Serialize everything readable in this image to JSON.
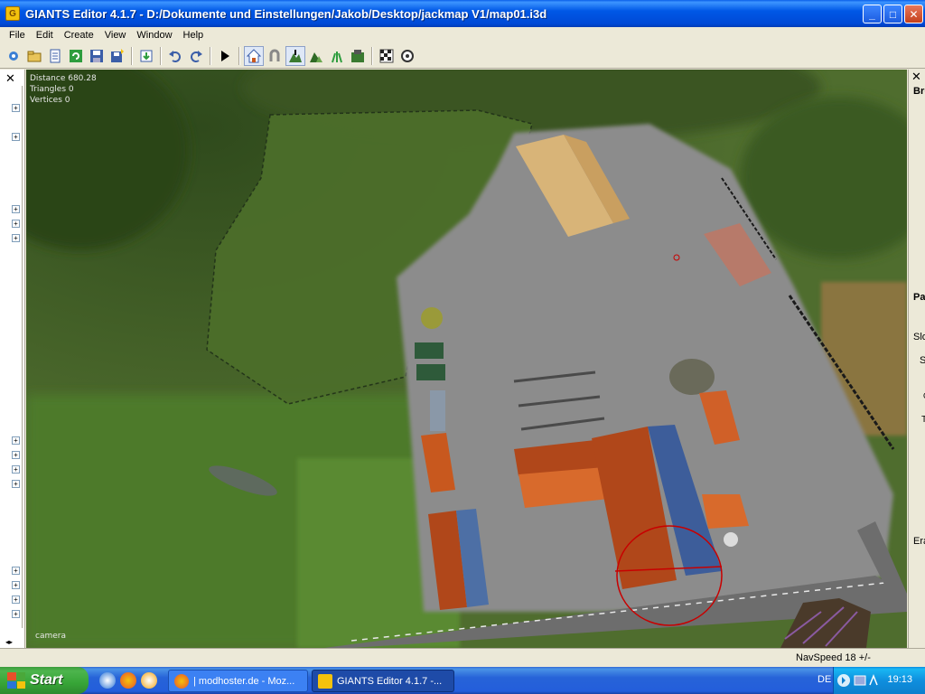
{
  "window": {
    "title": "GIANTS Editor 4.1.7 - D:/Dokumente und Einstellungen/Jakob/Desktop/jackmap V1/map01.i3d",
    "app_icon": "giants-logo-icon",
    "minimize": "_",
    "maximize": "□",
    "close": "✕"
  },
  "menu": {
    "items": [
      {
        "label": "File"
      },
      {
        "label": "Edit"
      },
      {
        "label": "Create"
      },
      {
        "label": "View"
      },
      {
        "label": "Window"
      },
      {
        "label": "Help"
      }
    ]
  },
  "toolbar": {
    "buttons": [
      "new-scene-icon",
      "open-icon",
      "list-icon",
      "refresh-icon",
      "save-icon",
      "save-as-icon",
      "import-icon",
      "undo-icon",
      "redo-icon",
      "play-icon",
      "home-icon",
      "magnet-icon",
      "terrain-sculpt-icon",
      "terrain-paint-icon",
      "foliage-paint-icon",
      "texture-paint-icon",
      "checker-icon",
      "snapshot-icon"
    ]
  },
  "scenegraph": {
    "close": "✕",
    "expanders": [
      "+",
      "+",
      "+",
      "+",
      "+",
      "+",
      "+",
      "+",
      "+",
      "+",
      "+",
      "+",
      "+",
      "+",
      "+",
      "+"
    ],
    "scroll": "◂▸"
  },
  "viewport": {
    "distance": "Distance 680.28",
    "triangles": "Triangles 0",
    "vertices": "Vertices 0",
    "camera": "camera"
  },
  "rightpanel": {
    "close": "✕",
    "labels": [
      "Bru",
      "Pa",
      "Slo",
      "S",
      "C",
      "T",
      "Era"
    ]
  },
  "status": {
    "navspeed": "NavSpeed 18 +/-"
  },
  "taskbar": {
    "start": "Start",
    "tasks": [
      {
        "label": "| modhoster.de - Moz..."
      },
      {
        "label": "GIANTS Editor 4.1.7 -..."
      }
    ],
    "language": "DE",
    "time": "19:13"
  },
  "colors": {
    "titlebar": "#0054e3",
    "grass": "#4d6b2c",
    "yard": "#8a8a8a",
    "roof_orange": "#c8581e",
    "selection": "#d00000"
  }
}
